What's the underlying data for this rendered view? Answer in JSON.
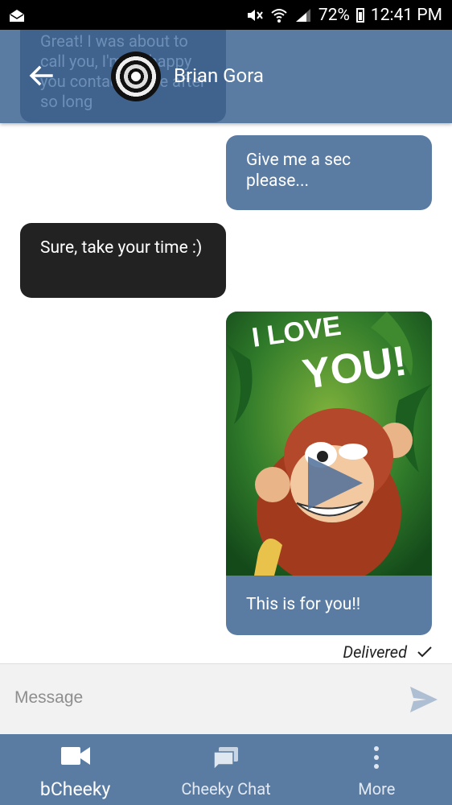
{
  "status_bar": {
    "battery": "72%",
    "time": "12:41 PM"
  },
  "header": {
    "contact_name": "Brian Gora",
    "peek_message": "Great! I was about to call you, I'm so happy you contacted me after so long"
  },
  "messages": [
    {
      "direction": "outgoing",
      "text": "Give me a sec please..."
    },
    {
      "direction": "incoming",
      "text": "Sure, take your time :)"
    },
    {
      "direction": "outgoing",
      "type": "video",
      "image_text_line1": "I LOVE",
      "image_text_line2": "YOU!",
      "caption": "This is for you!!"
    }
  ],
  "delivery_status": "Delivered",
  "composer": {
    "placeholder": "Message"
  },
  "nav": {
    "items": [
      {
        "label": "bCheeky",
        "icon": "video-camera-icon",
        "active": true
      },
      {
        "label": "Cheeky Chat",
        "icon": "chat-icon",
        "active": false
      },
      {
        "label": "More",
        "icon": "more-vertical-icon",
        "active": false
      }
    ]
  },
  "colors": {
    "primary": "#5b7ca2",
    "incoming_bubble": "#222222",
    "peek_bubble": "#3f628c"
  }
}
